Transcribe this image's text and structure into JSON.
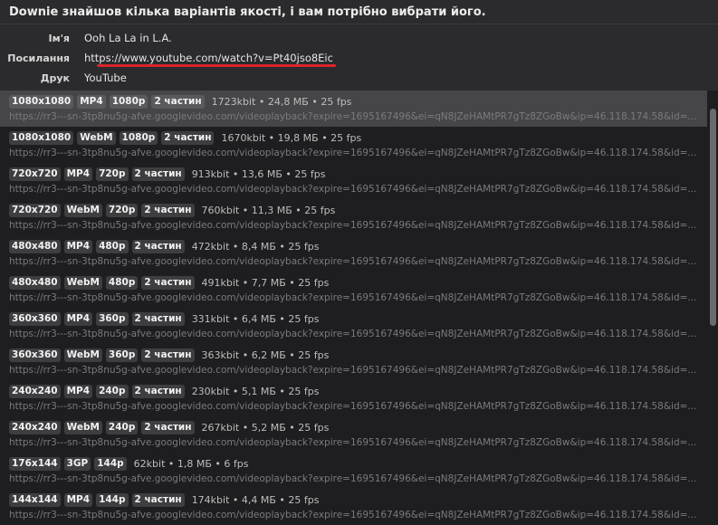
{
  "header": {
    "title": "Downie знайшов кілька варіантів якості, і вам потрібно вибрати його."
  },
  "meta": {
    "name_label": "Ім'я",
    "name_value": "Ooh La La in L.A.",
    "link_label": "Посилання",
    "link_value": "https://www.youtube.com/watch?v=Pt40jso8Eic",
    "print_label": "Друк",
    "print_value": "YouTube"
  },
  "colors": {
    "accent_underline": "#d9242b",
    "selected_row": "#464649"
  },
  "items": [
    {
      "res": "1080x1080",
      "fmt": "MP4",
      "q": "1080p",
      "parts": "2 частин",
      "stats": "1723kbit • 24,8 МБ • 25 fps",
      "url": "https://rr3---sn-3tp8nu5g-afve.googlevideo.com/videoplayback?expire=1695167496&ei=qN8JZeHAMtPR7gTz8ZGoBw&ip=46.118.174.58&id=..."
    },
    {
      "res": "1080x1080",
      "fmt": "WebM",
      "q": "1080p",
      "parts": "2 частин",
      "stats": "1670kbit • 19,8 МБ • 25 fps",
      "url": "https://rr3---sn-3tp8nu5g-afve.googlevideo.com/videoplayback?expire=1695167496&ei=qN8JZeHAMtPR7gTz8ZGoBw&ip=46.118.174.58&id=..."
    },
    {
      "res": "720x720",
      "fmt": "MP4",
      "q": "720p",
      "parts": "2 частин",
      "stats": "913kbit • 13,6 МБ • 25 fps",
      "url": "https://rr3---sn-3tp8nu5g-afve.googlevideo.com/videoplayback?expire=1695167496&ei=qN8JZeHAMtPR7gTz8ZGoBw&ip=46.118.174.58&id=..."
    },
    {
      "res": "720x720",
      "fmt": "WebM",
      "q": "720p",
      "parts": "2 частин",
      "stats": "760kbit • 11,3 МБ • 25 fps",
      "url": "https://rr3---sn-3tp8nu5g-afve.googlevideo.com/videoplayback?expire=1695167496&ei=qN8JZeHAMtPR7gTz8ZGoBw&ip=46.118.174.58&id=..."
    },
    {
      "res": "480x480",
      "fmt": "MP4",
      "q": "480p",
      "parts": "2 частин",
      "stats": "472kbit • 8,4 МБ • 25 fps",
      "url": "https://rr3---sn-3tp8nu5g-afve.googlevideo.com/videoplayback?expire=1695167496&ei=qN8JZeHAMtPR7gTz8ZGoBw&ip=46.118.174.58&id=..."
    },
    {
      "res": "480x480",
      "fmt": "WebM",
      "q": "480p",
      "parts": "2 частин",
      "stats": "491kbit • 7,7 МБ • 25 fps",
      "url": "https://rr3---sn-3tp8nu5g-afve.googlevideo.com/videoplayback?expire=1695167496&ei=qN8JZeHAMtPR7gTz8ZGoBw&ip=46.118.174.58&id=..."
    },
    {
      "res": "360x360",
      "fmt": "MP4",
      "q": "360p",
      "parts": "2 частин",
      "stats": "331kbit • 6,4 МБ • 25 fps",
      "url": "https://rr3---sn-3tp8nu5g-afve.googlevideo.com/videoplayback?expire=1695167496&ei=qN8JZeHAMtPR7gTz8ZGoBw&ip=46.118.174.58&id=..."
    },
    {
      "res": "360x360",
      "fmt": "WebM",
      "q": "360p",
      "parts": "2 частин",
      "stats": "363kbit • 6,2 МБ • 25 fps",
      "url": "https://rr3---sn-3tp8nu5g-afve.googlevideo.com/videoplayback?expire=1695167496&ei=qN8JZeHAMtPR7gTz8ZGoBw&ip=46.118.174.58&id=..."
    },
    {
      "res": "240x240",
      "fmt": "MP4",
      "q": "240p",
      "parts": "2 частин",
      "stats": "230kbit • 5,1 МБ • 25 fps",
      "url": "https://rr3---sn-3tp8nu5g-afve.googlevideo.com/videoplayback?expire=1695167496&ei=qN8JZeHAMtPR7gTz8ZGoBw&ip=46.118.174.58&id=..."
    },
    {
      "res": "240x240",
      "fmt": "WebM",
      "q": "240p",
      "parts": "2 частин",
      "stats": "267kbit • 5,2 МБ • 25 fps",
      "url": "https://rr3---sn-3tp8nu5g-afve.googlevideo.com/videoplayback?expire=1695167496&ei=qN8JZeHAMtPR7gTz8ZGoBw&ip=46.118.174.58&id=..."
    },
    {
      "res": "176x144",
      "fmt": "3GP",
      "q": "144p",
      "parts": "",
      "stats": "62kbit • 1,8 МБ • 6 fps",
      "url": "https://rr3---sn-3tp8nu5g-afve.googlevideo.com/videoplayback?expire=1695167496&ei=qN8JZeHAMtPR7gTz8ZGoBw&ip=46.118.174.58&id=..."
    },
    {
      "res": "144x144",
      "fmt": "MP4",
      "q": "144p",
      "parts": "2 частин",
      "stats": "174kbit • 4,4 МБ • 25 fps",
      "url": "https://rr3---sn-3tp8nu5g-afve.googlevideo.com/videoplayback?expire=1695167496&ei=qN8JZeHAMtPR7gTz8ZGoBw&ip=46.118.174.58&id=..."
    }
  ]
}
